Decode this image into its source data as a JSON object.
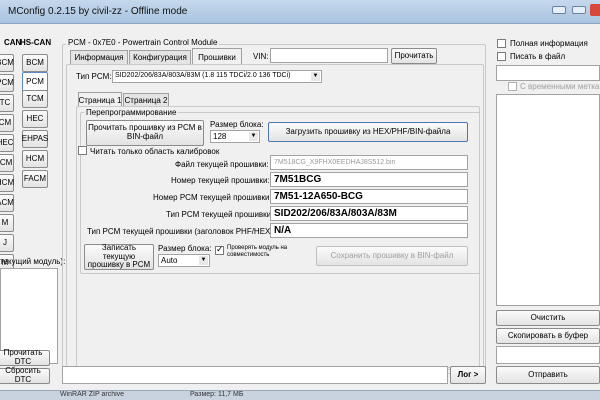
{
  "window": {
    "title": "MConfig 0.2.15 by civil-zz - Offline mode"
  },
  "left": {
    "ms_can_header": "CAN",
    "hs_can_header": "HS-CAN",
    "ms_modules": [
      "BCM",
      "PCM",
      "TC",
      "CM",
      "HEC",
      "ICM",
      "HCM",
      "ACM",
      "M",
      "J",
      "M"
    ],
    "hs_modules": [
      "BCM",
      "PCM",
      "TCM",
      "HEC",
      "EHPAS",
      "HCM",
      "FACM"
    ],
    "current_module_label": "текущий модуль):",
    "read_dtc": "Прочитать DTC",
    "clear_dtc": "Сбросить DTC"
  },
  "pcm": {
    "header": "PCM - 0x7E0 - Powertrain Control Module",
    "tabs": [
      "Информация",
      "Конфигурация",
      "Прошивки"
    ],
    "vin_label": "VIN:",
    "vin_value": "",
    "read_button": "Прочитать",
    "type_label": "Тип PCM:",
    "type_value": "SID202/206/83A/803A/83M (1.8 115 TDCi/2.0 136 TDCi)",
    "subtabs": [
      "Страница 1",
      "Страница 2"
    ],
    "reprog_group": "Перепрограммирование",
    "read_fw_button": "Прочитать прошивку из PCM в BIN-файл",
    "block_size_label": "Размер блока:",
    "block_size_value": "128",
    "load_fw_button": "Загрузить прошивку из HEX/PHF/BIN-файла",
    "read_calib_only": "Читать только область калибровок",
    "fields": [
      {
        "label": "Файл текущей прошивки:",
        "value": "7M518CG_X9FHX0EEDHAJ8S512.bin",
        "style": "gray"
      },
      {
        "label": "Номер текущей прошивки:",
        "value": "7M51BCG",
        "style": "bold"
      },
      {
        "label": "Номер PCM текущей прошивки:",
        "value": "7M51-12A650-BCG",
        "style": "bold"
      },
      {
        "label": "Тип PCM текущей прошивки:",
        "value": "SID202/206/83A/803A/83M",
        "style": "bold"
      },
      {
        "label": "Тип PCM текущей прошивки (заголовок PHF/HEX):",
        "value": "N/A",
        "style": "bold"
      }
    ],
    "write_fw_button": "Записать текущую прошивку в PCM",
    "block_size_label2": "Размер блока:",
    "block_size_value2": "Auto",
    "check_compat": "Проверять модуль на совместимость",
    "save_fw_button": "Сохранить прошивку в BIN-файл",
    "log_button": "Лог >"
  },
  "right": {
    "full_info": "Полная информация",
    "write_to_file": "Писать в файл",
    "with_time": "С временными метками",
    "clear_button": "Очистить",
    "copy_button": "Скопировать в буфер",
    "send_button": "Отправить"
  },
  "taskbar": {
    "text1": "WinRAR ZIP archive",
    "text2": "Размер: 11,7 МБ"
  }
}
